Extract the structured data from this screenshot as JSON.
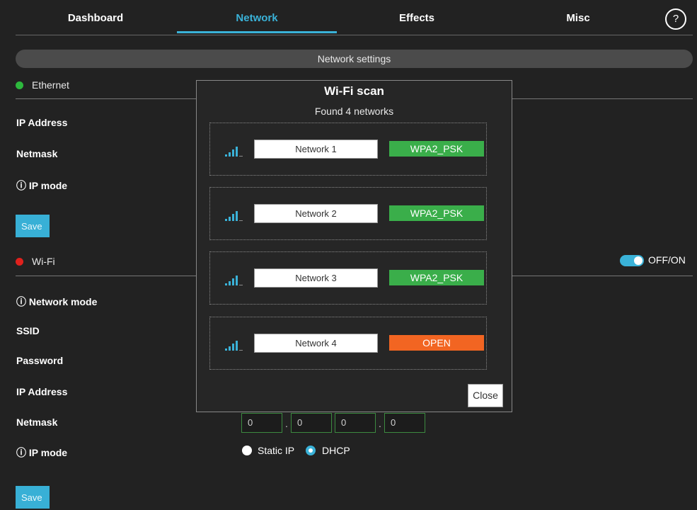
{
  "nav": {
    "tabs": [
      "Dashboard",
      "Network",
      "Effects",
      "Misc"
    ],
    "active_tab": "Network",
    "help_label": "?"
  },
  "section": {
    "title": "Network settings"
  },
  "ethernet": {
    "label": "Ethernet",
    "status_color": "#2db83d",
    "fields": [
      "IP Address",
      "Netmask",
      "ⓘ IP mode"
    ],
    "save_label": "Save"
  },
  "wifi": {
    "label": "Wi-Fi",
    "status_color": "#e0211d",
    "toggle_label": "OFF/ON",
    "toggle_on": true,
    "fields": [
      "ⓘ Network mode",
      "SSID",
      "Password",
      "IP Address",
      "Netmask",
      "ⓘ IP mode"
    ],
    "netmask": [
      "0",
      "0",
      "0",
      "0"
    ],
    "ip_mode_options": [
      "Static IP",
      "DHCP"
    ],
    "ip_mode_selected": "DHCP",
    "save_label": "Save"
  },
  "scan_modal": {
    "title": "Wi-Fi scan",
    "subtitle": "Found 4 networks",
    "networks": [
      {
        "name": "Network 1",
        "security": "WPA2_PSK",
        "color": "#3aae4a",
        "icon": "signal-icon"
      },
      {
        "name": "Network 2",
        "security": "WPA2_PSK",
        "color": "#3aae4a",
        "icon": "signal-icon"
      },
      {
        "name": "Network 3",
        "security": "WPA2_PSK",
        "color": "#3aae4a",
        "icon": "signal-icon"
      },
      {
        "name": "Network 4",
        "security": "OPEN",
        "color": "#f26522",
        "icon": "signal-icon"
      }
    ],
    "close_label": "Close"
  },
  "colors": {
    "accent": "#3ab2d8",
    "background": "#222222"
  }
}
